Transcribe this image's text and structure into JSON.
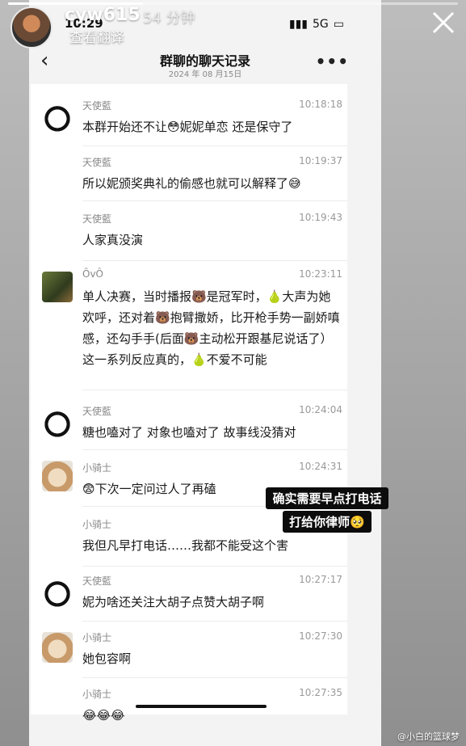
{
  "story": {
    "username": "cyw615",
    "time_ago": "54 分钟",
    "translate_label": "查看翻译",
    "close_icon": "close-icon"
  },
  "phone": {
    "clock": "10:29",
    "network": "5G",
    "nav_title": "群聊的聊天记录",
    "nav_date": "2024 年 08 月15日",
    "back_icon": "chevron-left-icon",
    "more_icon": "more-icon"
  },
  "messages": [
    {
      "name": "天使藍",
      "time": "10:18:18",
      "text": "本群开始还不让😳妮妮单恋 还是保守了"
    },
    {
      "name": "天使藍",
      "time": "10:19:37",
      "text": "所以妮颁奖典礼的偷感也就可以解释了😅"
    },
    {
      "name": "天使藍",
      "time": "10:19:43",
      "text": "人家真没演"
    },
    {
      "name": "ÕvÔ",
      "time": "10:23:11",
      "text": "单人决赛，当时播报🐻是冠军时，🍐大声为她欢呼，还对着🐻抱臂撒娇，比开枪手势一副娇嗔感，还勾手手(后面🐻主动松开跟基尼说话了）这一系列反应真的，🍐不爱不可能"
    },
    {
      "name": "天使藍",
      "time": "10:24:04",
      "text": "糖也嗑对了 对象也嗑对了 故事线没猜对"
    },
    {
      "name": "小骑士",
      "time": "10:24:31",
      "text": "😨下次一定问过人了再磕"
    },
    {
      "name": "小骑士",
      "time": "",
      "text": "我但凡早打电话……我都不能受这个害"
    },
    {
      "name": "天使藍",
      "time": "10:27:17",
      "text": "妮为啥还关注大胡子点赞大胡子啊"
    },
    {
      "name": "小骑士",
      "time": "10:27:30",
      "text": "她包容啊"
    },
    {
      "name": "小骑士",
      "time": "10:27:35",
      "text": "😂😂😂"
    }
  ],
  "overlay": {
    "line1": "确实需要早点打电话",
    "line2": "打给你律师🥺"
  },
  "watermark": "@小白的篮球梦"
}
